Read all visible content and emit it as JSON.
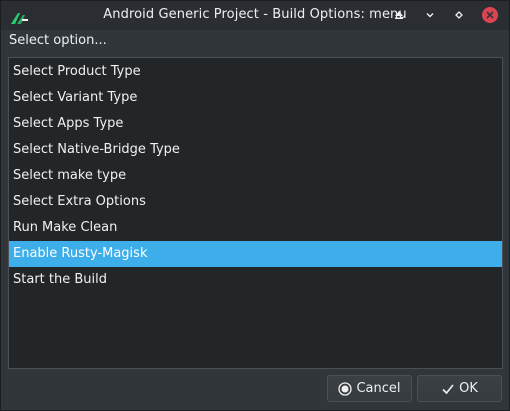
{
  "window": {
    "title": "Android Generic Project - Build Options: menu",
    "buttons": {
      "keep_above": "keep-above-icon",
      "minimize": "minimize-icon",
      "maximize": "maximize-icon",
      "close": "close-icon"
    },
    "close_color": "#da4453"
  },
  "prompt": "Select option...",
  "menu": {
    "items": [
      {
        "label": "Select Product Type"
      },
      {
        "label": "Select Variant Type"
      },
      {
        "label": "Select Apps Type"
      },
      {
        "label": "Select Native-Bridge Type"
      },
      {
        "label": "Select make type"
      },
      {
        "label": "Select Extra Options"
      },
      {
        "label": "Run Make Clean"
      },
      {
        "label": "Enable Rusty-Magisk"
      },
      {
        "label": "Start the Build"
      }
    ],
    "selected_index": 7,
    "selection_color": "#3daee9"
  },
  "actions": {
    "cancel_label": "Cancel",
    "cancel_icon": "cancel-circle-icon",
    "ok_label": "OK",
    "ok_icon": "checkmark-icon"
  }
}
